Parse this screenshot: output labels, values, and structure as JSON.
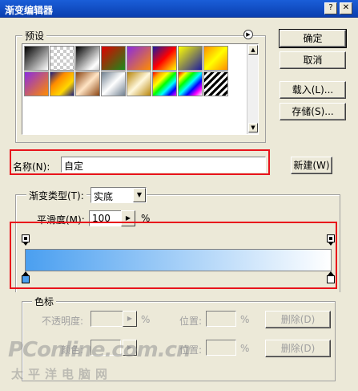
{
  "window": {
    "title": "渐变编辑器",
    "help_label": "?",
    "close_label": "✕"
  },
  "presets": {
    "label": "预设",
    "menu_icon": "arrow-circle-icon"
  },
  "buttons": {
    "ok": "确定",
    "cancel": "取消",
    "load": "载入(L)...",
    "save": "存储(S)...",
    "new": "新建(W)",
    "delete_opacity": "删除(D)",
    "delete_color": "删除(D)"
  },
  "name_field": {
    "label": "名称(N):",
    "value": "自定"
  },
  "gradient_type": {
    "label": "渐变类型(T):",
    "value": "实底"
  },
  "smoothness": {
    "label": "平滑度(M):",
    "value": "100",
    "unit": "%"
  },
  "colors": {
    "start": "#4a9ff0",
    "end": "#ffffff",
    "highlight": "#e8131b"
  },
  "stops_group": {
    "label": "色标",
    "opacity_label": "不透明度:",
    "opacity_unit": "%",
    "location_label_1": "位置:",
    "location_unit_1": "%",
    "color_label": "颜色:",
    "location_label_2": "位置:",
    "location_unit_2": "%"
  },
  "watermark": {
    "line1": "PConline.com.cn",
    "line2": "太平洋电脑网"
  }
}
